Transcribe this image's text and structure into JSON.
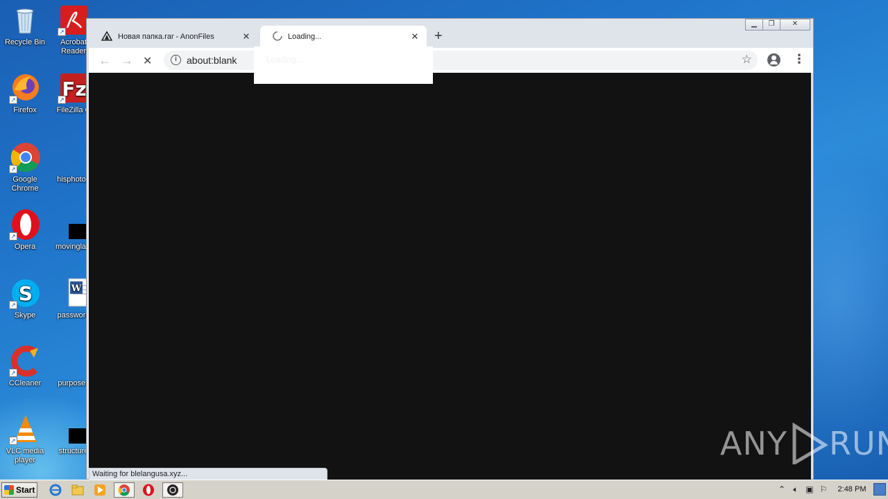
{
  "desktop": {
    "icons": [
      {
        "label": "Recycle Bin",
        "icon": "recycle-bin-icon"
      },
      {
        "label": "Acrobat Reader",
        "icon": "acrobat-reader-icon"
      },
      {
        "label": "Firefox",
        "icon": "firefox-icon"
      },
      {
        "label": "FileZilla C",
        "icon": "filezilla-icon"
      },
      {
        "label": "Google Chrome",
        "icon": "chrome-icon"
      },
      {
        "label": "hisphotog",
        "icon": "file-icon"
      },
      {
        "label": "Opera",
        "icon": "opera-icon"
      },
      {
        "label": "movinglaw",
        "icon": "file-icon"
      },
      {
        "label": "Skype",
        "icon": "skype-icon"
      },
      {
        "label": "password",
        "icon": "word-doc-icon"
      },
      {
        "label": "CCleaner",
        "icon": "ccleaner-icon"
      },
      {
        "label": "purposes",
        "icon": "file-icon"
      },
      {
        "label": "VLC media player",
        "icon": "vlc-icon"
      },
      {
        "label": "structure",
        "icon": "file-icon"
      }
    ]
  },
  "browser": {
    "tabs": [
      {
        "title": "Новая папка.rar - AnonFiles",
        "icon": "anonfiles-icon"
      },
      {
        "title": "Loading...",
        "icon": "loading-spinner-icon"
      }
    ],
    "address": "about:blank",
    "dropdown_text": "Loading...",
    "status_text": "Waiting for blelangusa.xyz..."
  },
  "watermark": {
    "left": "ANY",
    "right": "RUN"
  },
  "taskbar": {
    "start_label": "Start",
    "clock": "2:48 PM"
  },
  "colors": {
    "desktop_blue": "#1f74c9",
    "content_bg": "#121212",
    "taskbar": "#d5d2ca"
  }
}
